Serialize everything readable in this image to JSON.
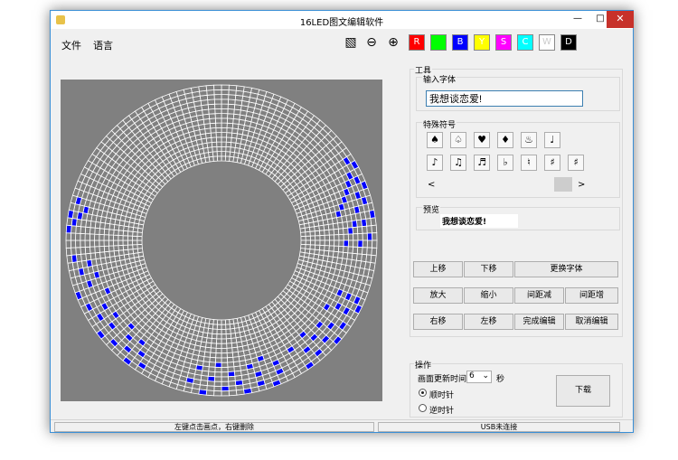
{
  "window": {
    "title": "16LED图文编辑软件",
    "minimize": "—",
    "maximize": "□",
    "close": "✕"
  },
  "menu": {
    "file": "文件",
    "language": "语言"
  },
  "toolbar": {
    "tools": [
      "select-icon",
      "zoom-out-icon",
      "zoom-in-icon"
    ],
    "colors": [
      {
        "label": "R",
        "color": "#ff0000",
        "text": "#ffffff"
      },
      {
        "label": "",
        "color": "#00ff00",
        "text": "#ffffff"
      },
      {
        "label": "B",
        "color": "#0000ff",
        "text": "#ffffff"
      },
      {
        "label": "Y",
        "color": "#ffff00",
        "text": "#ffffff"
      },
      {
        "label": "S",
        "color": "#ff00ff",
        "text": "#ffffff"
      },
      {
        "label": "C",
        "color": "#00ffff",
        "text": "#ffffff"
      },
      {
        "label": "W",
        "color": "#ffffff",
        "text": "#cccccc"
      },
      {
        "label": "D",
        "color": "#000000",
        "text": "#ffffff"
      }
    ]
  },
  "tools": {
    "group_label": "工具",
    "font_input": {
      "label": "输入字体",
      "value": "我想谈恋爱!"
    },
    "symbols": {
      "label": "特殊符号",
      "row1": [
        "♠",
        "♤",
        "♥",
        "♦",
        "♨",
        "♩"
      ],
      "row2": [
        "♪",
        "♫",
        "♬",
        "♭",
        "♮",
        "♯",
        "♯"
      ],
      "scroll_left": "<",
      "scroll_right": ">"
    },
    "preview": {
      "label": "预览",
      "text": "我想谈恋爱!"
    },
    "buttons": [
      {
        "label": "上移"
      },
      {
        "label": "下移"
      },
      {
        "label": "更换字体"
      },
      {
        "label": "放大"
      },
      {
        "label": "缩小"
      },
      {
        "label": "间距减"
      },
      {
        "label": "间距增"
      },
      {
        "label": "右移"
      },
      {
        "label": "左移"
      },
      {
        "label": "完成编辑"
      },
      {
        "label": "取消编辑"
      }
    ]
  },
  "operation": {
    "group_label": "操作",
    "refresh_label": "画面更新时间",
    "refresh_value": "6",
    "refresh_unit": "秒",
    "clockwise": "顺时针",
    "counterclockwise": "逆时针",
    "direction_selected": "clockwise",
    "download": "下载"
  },
  "status": {
    "hint": "左键点击画点，右键删除",
    "usb": "USB未连接"
  },
  "led_display": {
    "rings": 16,
    "segments": 128,
    "colors": {
      "background": "#808080",
      "grid": "#ffffff",
      "lit": "#0000ff"
    },
    "lit_cells": [
      [
        14,
        20
      ],
      [
        15,
        21
      ],
      [
        13,
        22
      ],
      [
        12,
        23
      ],
      [
        14,
        23
      ],
      [
        11,
        24
      ],
      [
        15,
        24
      ],
      [
        10,
        25
      ],
      [
        13,
        25
      ],
      [
        9,
        26
      ],
      [
        14,
        26
      ],
      [
        8,
        27
      ],
      [
        12,
        27
      ],
      [
        15,
        28
      ],
      [
        11,
        29
      ],
      [
        13,
        29
      ],
      [
        10,
        30
      ],
      [
        14,
        31
      ],
      [
        9,
        32
      ],
      [
        12,
        32
      ],
      [
        14,
        40
      ],
      [
        12,
        40
      ],
      [
        10,
        40
      ],
      [
        15,
        41
      ],
      [
        13,
        42
      ],
      [
        11,
        42
      ],
      [
        9,
        43
      ],
      [
        14,
        44
      ],
      [
        12,
        45
      ],
      [
        10,
        46
      ],
      [
        15,
        46
      ],
      [
        13,
        47
      ],
      [
        11,
        48
      ],
      [
        14,
        49
      ],
      [
        9,
        49
      ],
      [
        12,
        50
      ],
      [
        15,
        51
      ],
      [
        10,
        52
      ],
      [
        13,
        55
      ],
      [
        11,
        55
      ],
      [
        15,
        56
      ],
      [
        9,
        57
      ],
      [
        14,
        58
      ],
      [
        12,
        58
      ],
      [
        10,
        59
      ],
      [
        15,
        60
      ],
      [
        13,
        61
      ],
      [
        11,
        62
      ],
      [
        14,
        63
      ],
      [
        9,
        64
      ],
      [
        12,
        65
      ],
      [
        15,
        66
      ],
      [
        10,
        67
      ],
      [
        13,
        68
      ],
      [
        14,
        75
      ],
      [
        12,
        76
      ],
      [
        15,
        77
      ],
      [
        10,
        77
      ],
      [
        13,
        78
      ],
      [
        11,
        79
      ],
      [
        9,
        80
      ],
      [
        14,
        80
      ],
      [
        15,
        82
      ],
      [
        12,
        82
      ],
      [
        10,
        83
      ],
      [
        13,
        84
      ],
      [
        11,
        85
      ],
      [
        14,
        86
      ],
      [
        9,
        87
      ],
      [
        15,
        88
      ],
      [
        12,
        89
      ],
      [
        10,
        90
      ],
      [
        13,
        91
      ],
      [
        11,
        92
      ],
      [
        14,
        93
      ],
      [
        15,
        97
      ],
      [
        14,
        98
      ],
      [
        13,
        99
      ],
      [
        15,
        99
      ],
      [
        12,
        100
      ],
      [
        14,
        101
      ]
    ]
  }
}
